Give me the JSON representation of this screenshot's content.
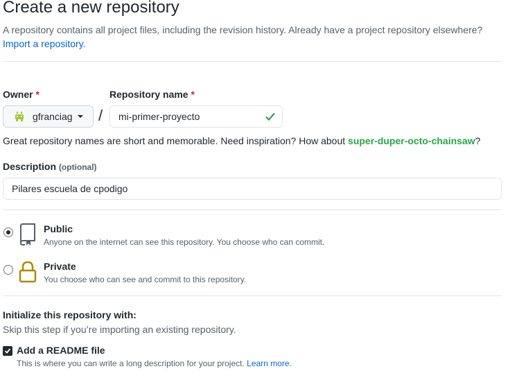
{
  "page": {
    "title": "Create a new repository",
    "intro": "A repository contains all project files, including the revision history. Already have a project repository elsewhere?",
    "import_link": "Import a repository."
  },
  "owner": {
    "label": "Owner",
    "required_mark": "*",
    "value": "gfranciag",
    "avatar_icon": "android-avatar-icon"
  },
  "separator": "/",
  "repo_name": {
    "label": "Repository name",
    "required_mark": "*",
    "value": "mi-primer-proyecto",
    "valid_icon": "check-icon",
    "valid_color": "#28a745"
  },
  "name_hint": {
    "text": "Great repository names are short and memorable. Need inspiration? How about",
    "suggestion": "super-duper-octo-chainsaw",
    "end": "?"
  },
  "description": {
    "label": "Description",
    "optional": "(optional)",
    "value": "Pilares escuela de cpodigo"
  },
  "visibility": {
    "options": [
      {
        "id": "public",
        "title": "Public",
        "note": "Anyone on the internet can see this repository. You choose who can commit.",
        "icon": "repo-book-icon",
        "selected": true
      },
      {
        "id": "private",
        "title": "Private",
        "note": "You choose who can see and commit to this repository.",
        "icon": "lock-icon",
        "selected": false
      }
    ]
  },
  "init": {
    "heading": "Initialize this repository with:",
    "subtext": "Skip this step if you’re importing an existing repository.",
    "readme": {
      "label": "Add a README file",
      "checked": true,
      "note": "This is where you can write a long description for your project.",
      "learn_more": "Learn more."
    }
  },
  "colors": {
    "link": "#0366d6",
    "required": "#cb2431",
    "success": "#28a745",
    "lock": "#b08800"
  }
}
